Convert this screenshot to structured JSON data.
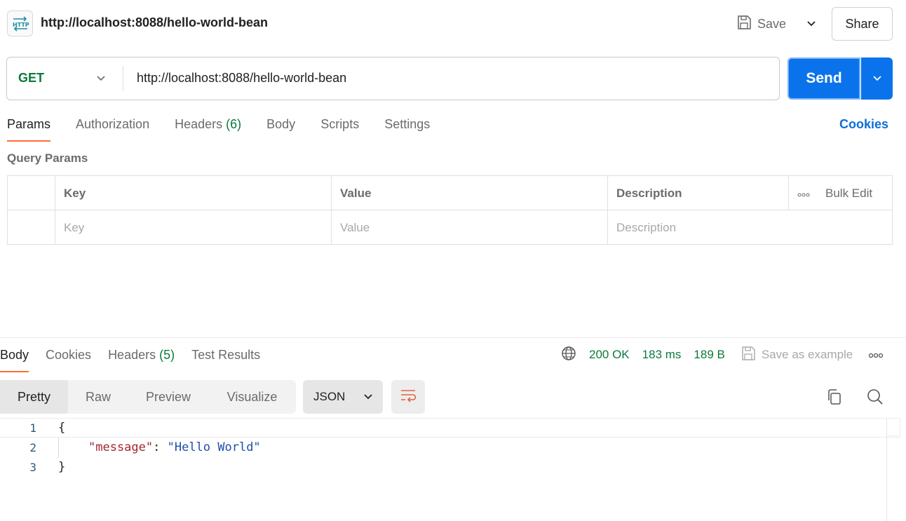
{
  "request": {
    "title": "http://localhost:8088/hello-world-bean",
    "save_label": "Save",
    "share_label": "Share",
    "method": "GET",
    "url": "http://localhost:8088/hello-world-bean",
    "send_label": "Send"
  },
  "request_tabs": {
    "params": "Params",
    "authorization": "Authorization",
    "headers": "Headers",
    "headers_count": "(6)",
    "body": "Body",
    "scripts": "Scripts",
    "settings": "Settings",
    "cookies": "Cookies"
  },
  "query_params": {
    "label": "Query Params",
    "columns": {
      "key": "Key",
      "value": "Value",
      "description": "Description",
      "bulk_edit": "Bulk Edit"
    },
    "placeholders": {
      "key": "Key",
      "value": "Value",
      "description": "Description"
    }
  },
  "response_tabs": {
    "body": "Body",
    "cookies": "Cookies",
    "headers": "Headers",
    "headers_count": "(5)",
    "test_results": "Test Results"
  },
  "response_status": {
    "status": "200 OK",
    "time": "183 ms",
    "size": "189 B",
    "save_example": "Save as example"
  },
  "view_options": {
    "pretty": "Pretty",
    "raw": "Raw",
    "preview": "Preview",
    "visualize": "Visualize",
    "format": "JSON"
  },
  "response_body": {
    "line_numbers": [
      "1",
      "2",
      "3"
    ],
    "open_brace": "{",
    "key": "\"message\"",
    "colon": ": ",
    "value": "\"Hello World\"",
    "close_brace": "}"
  },
  "colors": {
    "accent_send": "#0a73eb",
    "method_green": "#0b7a3b",
    "active_tab_underline": "#ff6c37",
    "link_blue": "#0a6fd8"
  }
}
